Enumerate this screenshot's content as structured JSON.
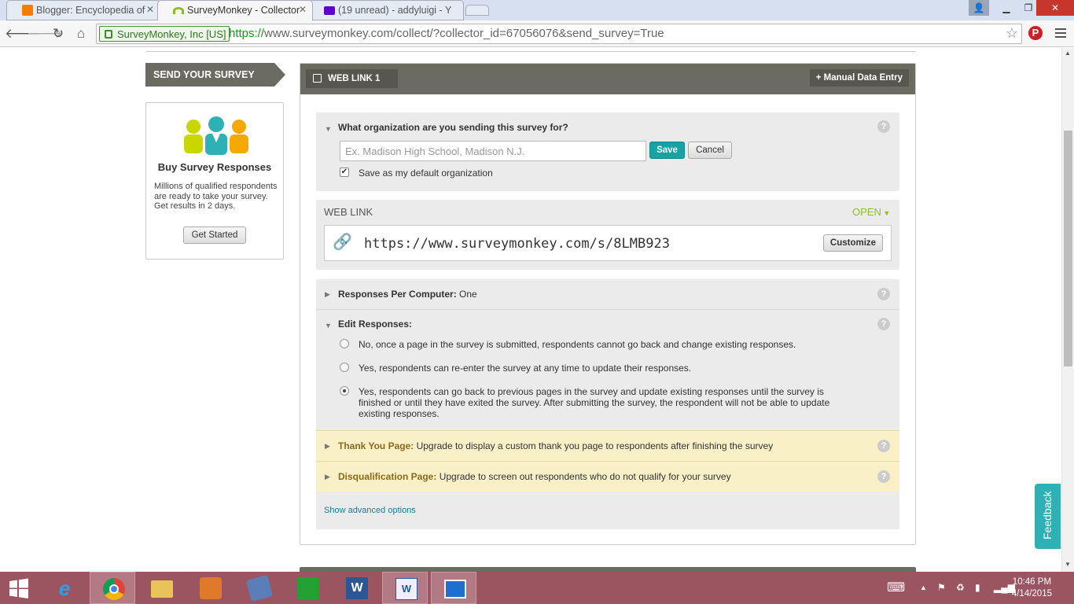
{
  "browser": {
    "tabs": [
      {
        "title": "Blogger: Encyclopedia of",
        "icon": "blogger-icon",
        "color": "#f57d00",
        "active": false
      },
      {
        "title": "SurveyMonkey - Collector",
        "icon": "surveymonkey-icon",
        "color": "#8cbf26",
        "active": true
      },
      {
        "title": "(19 unread) - addyluigi - Y",
        "icon": "yahoo-mail-icon",
        "color": "#5f01d1",
        "active": false
      }
    ],
    "ev_label": "SurveyMonkey, Inc [US]",
    "url_scheme": "https://",
    "url_rest": "www.surveymonkey.com/collect/?collector_id=67056076&send_survey=True"
  },
  "sidebar": {
    "send_label": "SEND YOUR SURVEY",
    "buy_title": "Buy Survey Responses",
    "buy_desc": "Millions of qualified respondents are ready to take your survey. Get results in 2 days.",
    "get_started": "Get Started"
  },
  "collector": {
    "tab_label": "WEB LINK 1",
    "manual_entry": "+ Manual Data Entry",
    "org_question": "What organization are you sending this survey for?",
    "org_placeholder": "Ex. Madison High School, Madison N.J.",
    "save": "Save",
    "cancel": "Cancel",
    "default_org_label": "Save as my default organization",
    "weblink_title": "WEB LINK",
    "status": "OPEN",
    "link_url": "https://www.surveymonkey.com/s/8LMB923",
    "customize": "Customize",
    "rpc_label": "Responses Per Computer:",
    "rpc_value": "One",
    "edit_label": "Edit Responses:",
    "edit_options": [
      "No, once a page in the survey is submitted, respondents cannot go back and change existing responses.",
      "Yes, respondents can re-enter the survey at any time to update their responses.",
      "Yes, respondents can go back to previous pages in the survey and update existing responses until the survey is finished or until they have exited the survey. After submitting the survey, the respondent will not be able to update existing responses."
    ],
    "thankyou_label": "Thank You Page:",
    "thankyou_text": "Upgrade to display a custom thank you page to respondents after finishing the survey",
    "disq_label": "Disqualification Page:",
    "disq_text": "Upgrade to screen out respondents who do not qualify for your survey",
    "advanced": "Show advanced options"
  },
  "feedback": "Feedback",
  "taskbar": {
    "time": "10:46 PM",
    "date": "4/14/2015"
  }
}
